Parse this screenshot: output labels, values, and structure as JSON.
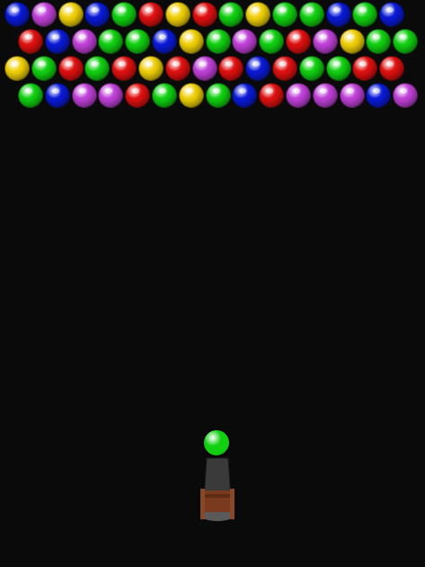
{
  "colors": {
    "R": "#e01010",
    "G": "#10d010",
    "B": "#0a1ad8",
    "Y": "#f0d008",
    "P": "#c040d8"
  },
  "grid": {
    "rows": [
      [
        "B",
        "P",
        "Y",
        "B",
        "G",
        "R",
        "Y",
        "R",
        "G",
        "Y",
        "G",
        "G",
        "B",
        "G",
        "B"
      ],
      [
        "R",
        "B",
        "P",
        "G",
        "G",
        "B",
        "Y",
        "G",
        "P",
        "G",
        "R",
        "P",
        "Y",
        "G",
        "G"
      ],
      [
        "Y",
        "G",
        "R",
        "G",
        "R",
        "Y",
        "R",
        "P",
        "R",
        "B",
        "R",
        "G",
        "G",
        "R",
        "R"
      ],
      [
        "G",
        "B",
        "P",
        "P",
        "R",
        "G",
        "Y",
        "G",
        "B",
        "R",
        "P",
        "P",
        "P",
        "B",
        "P"
      ]
    ]
  },
  "shooter": {
    "loaded_bubble_color": "G",
    "launcher_barrel_color": "#3a3a3a",
    "launcher_base_color": "#7a3a1e"
  }
}
